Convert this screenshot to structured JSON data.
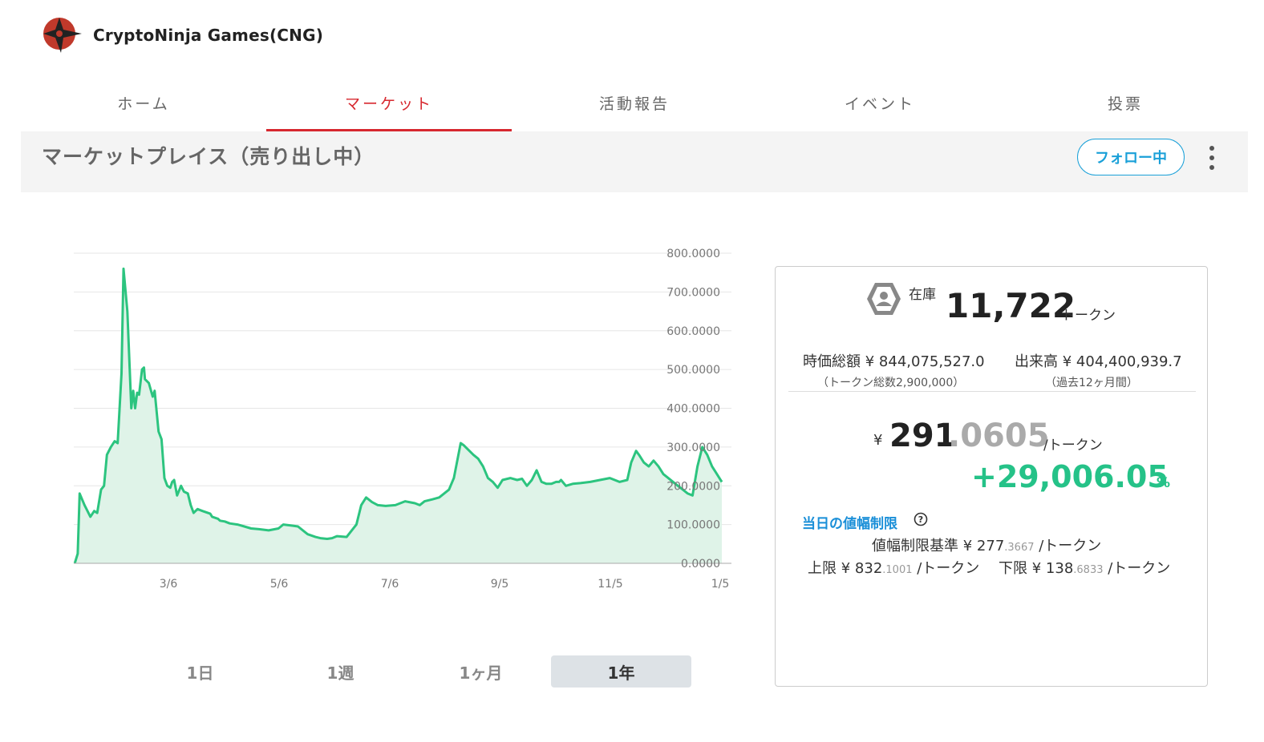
{
  "header": {
    "brand": "CryptoNinja Games(CNG)"
  },
  "tabs": [
    {
      "label": "ホーム",
      "active": false
    },
    {
      "label": "マーケット",
      "active": true
    },
    {
      "label": "活動報告",
      "active": false
    },
    {
      "label": "イベント",
      "active": false
    },
    {
      "label": "投票",
      "active": false
    }
  ],
  "subheader": {
    "title": "マーケットプレイス（売り出し中）",
    "follow_label": "フォロー中",
    "menu_icon": "kebab-icon"
  },
  "ranges": [
    {
      "label": "1日",
      "active": false
    },
    {
      "label": "1週",
      "active": false
    },
    {
      "label": "1ヶ月",
      "active": false
    },
    {
      "label": "1年",
      "active": true
    }
  ],
  "panel": {
    "stock_label": "在庫",
    "stock_value": "11,722",
    "stock_unit": "トークン",
    "market_cap_label": "時価総額",
    "market_cap_value": "¥ 844,075,527.0",
    "market_cap_note": "（トークン総数2,900,000）",
    "volume_label": "出来高",
    "volume_value": "¥ 404,400,939.7",
    "volume_note": "（過去12ヶ月間）",
    "price_currency": "¥",
    "price_int": "291",
    "price_dec": ".0605",
    "price_unit": "/トークン",
    "change": "+29,006.05",
    "change_unit": "%",
    "limit_title": "当日の値幅制限",
    "base_label": "値幅制限基準",
    "base_yen": "¥",
    "base_int": "277",
    "base_dec": ".3667",
    "upper_label": "上限",
    "upper_yen": "¥",
    "upper_int": "832",
    "upper_dec": ".1001",
    "lower_label": "下限",
    "lower_yen": "¥",
    "lower_int": "138",
    "lower_dec": ".6833",
    "per_token": "/トークン"
  },
  "colors": {
    "accent": "#d7282f",
    "link": "#1a8fd8",
    "up": "#25c288",
    "line": "#2cc47f"
  },
  "chart_data": {
    "type": "area",
    "x_tick_labels": [
      "3/6",
      "5/6",
      "7/6",
      "9/5",
      "11/5",
      "1/5"
    ],
    "y_tick_labels": [
      "0.0000",
      "100.0000",
      "200.0000",
      "300.0000",
      "400.0000",
      "500.0000",
      "600.0000",
      "700.0000",
      "800.0000"
    ],
    "ylim": [
      0,
      800
    ],
    "grid": true,
    "x": [
      1,
      4,
      6,
      11,
      17,
      21,
      24,
      28,
      31,
      34,
      38,
      42,
      45,
      49,
      51,
      55,
      59,
      61,
      63,
      65,
      67,
      70,
      72,
      73,
      77,
      81,
      83,
      87,
      90,
      93,
      96,
      99,
      101,
      103,
      106,
      110,
      113,
      117,
      120,
      123,
      127,
      132,
      140,
      142,
      148,
      150,
      155,
      160,
      168,
      175,
      182,
      190,
      200,
      210,
      215,
      225,
      230,
      240,
      248,
      253,
      260,
      265,
      270,
      280,
      290,
      295,
      300,
      306,
      312,
      320,
      330,
      340,
      350,
      355,
      360,
      368,
      375,
      380,
      385,
      390,
      397,
      400,
      406,
      410,
      415,
      420,
      425,
      430,
      435,
      440,
      448,
      455,
      460,
      465,
      470,
      475,
      480,
      485,
      490,
      495,
      498,
      500,
      505,
      512,
      520,
      530,
      540,
      550,
      560,
      568,
      572,
      577,
      580,
      585,
      590,
      595,
      600,
      605,
      610,
      615,
      620,
      625,
      630,
      635,
      640,
      645,
      650,
      655,
      660,
      665
    ],
    "y": [
      0,
      25,
      180,
      150,
      120,
      135,
      130,
      190,
      200,
      280,
      300,
      315,
      310,
      490,
      760,
      650,
      400,
      445,
      400,
      440,
      435,
      500,
      505,
      475,
      465,
      430,
      445,
      340,
      320,
      220,
      200,
      195,
      210,
      215,
      175,
      200,
      185,
      180,
      150,
      130,
      140,
      135,
      128,
      120,
      115,
      110,
      108,
      103,
      100,
      95,
      90,
      88,
      85,
      90,
      100,
      97,
      95,
      75,
      68,
      65,
      63,
      65,
      70,
      68,
      100,
      150,
      170,
      158,
      150,
      148,
      150,
      160,
      155,
      150,
      160,
      165,
      170,
      180,
      190,
      220,
      310,
      305,
      290,
      280,
      270,
      250,
      220,
      210,
      195,
      215,
      220,
      215,
      218,
      200,
      215,
      240,
      210,
      205,
      205,
      210,
      210,
      215,
      200,
      205,
      207,
      210,
      215,
      220,
      210,
      215,
      260,
      290,
      280,
      260,
      250,
      265,
      250,
      230,
      220,
      210,
      200,
      190,
      180,
      175,
      250,
      300,
      280,
      250,
      230,
      210
    ]
  }
}
